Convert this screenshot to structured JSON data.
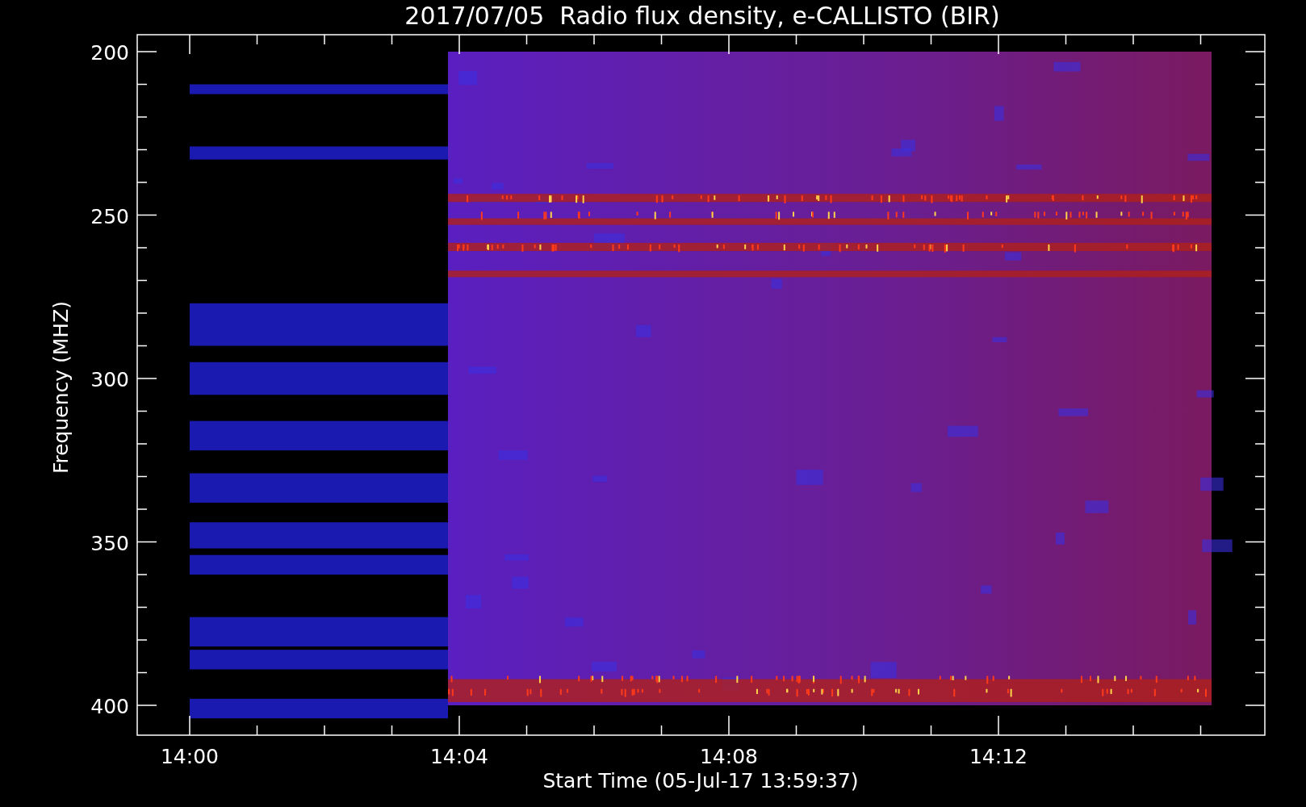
{
  "title": "2017/07/05  Radio flux density, e-CALLISTO (BIR)",
  "y_axis": {
    "label": "Frequency (MHZ)",
    "ticks": [
      "200",
      "250",
      "300",
      "350",
      "400"
    ]
  },
  "x_axis": {
    "label": "Start Time (05-Jul-17 13:59:37)",
    "ticks": [
      "14:00",
      "14:04",
      "14:08",
      "14:12"
    ]
  }
}
